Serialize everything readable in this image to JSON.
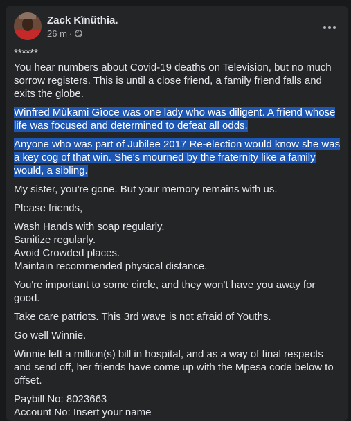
{
  "post": {
    "author": "Zack Kĩnũthia.",
    "time": "26 m",
    "separator": "·",
    "privacy_icon": "globe-icon",
    "more_icon": "more-options-icon",
    "highlight_color": "#1d56b3",
    "paragraphs": [
      "******",
      "You hear numbers about Covid-19 deaths on Television, but no much sorrow registers. This is until a close friend, a family friend falls and exits the globe.",
      "Winfred Mùkami Gìoce was one lady who was diligent. A friend whose life was focused and determined to defeat all odds.",
      "Anyone who was part of Jubilee 2017 Re-election would know she was a key cog of that win. She's mourned by the fraternity like a family would, a sibling.",
      "My sister, you're gone. But your memory remains with us.",
      "Please friends,",
      "Wash Hands with soap regularly.",
      "Sanitize regularly.",
      "Avoid Crowded places.",
      "Maintain recommended physical distance.",
      "You're important to some circle, and they won't have you away for good.",
      "Take care patriots. This 3rd wave is not afraid of Youths.",
      "Go well Winnie.",
      "Winnie left a million(s) bill in hospital, and as a way of final respects and send off, her friends have come up with the Mpesa code below to offset.",
      "Paybill No: 8023663",
      "Account No: Insert your name"
    ]
  }
}
